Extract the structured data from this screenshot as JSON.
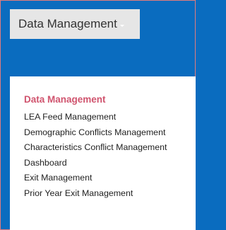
{
  "colors": {
    "background": "#0a6cbf",
    "header_bg": "#e6e6e6",
    "title": "#d0546e",
    "menu_text": "#222222"
  },
  "menu": {
    "label": "Data Management",
    "caret_icon": "chevron-down-icon"
  },
  "dropdown": {
    "title": "Data Management",
    "items": [
      {
        "label": "LEA Feed Management"
      },
      {
        "label": "Demographic Conflicts Management"
      },
      {
        "label": "Characteristics Conflict Management"
      },
      {
        "label": "Dashboard"
      },
      {
        "label": "Exit Management"
      },
      {
        "label": "Prior Year Exit Management"
      }
    ]
  }
}
